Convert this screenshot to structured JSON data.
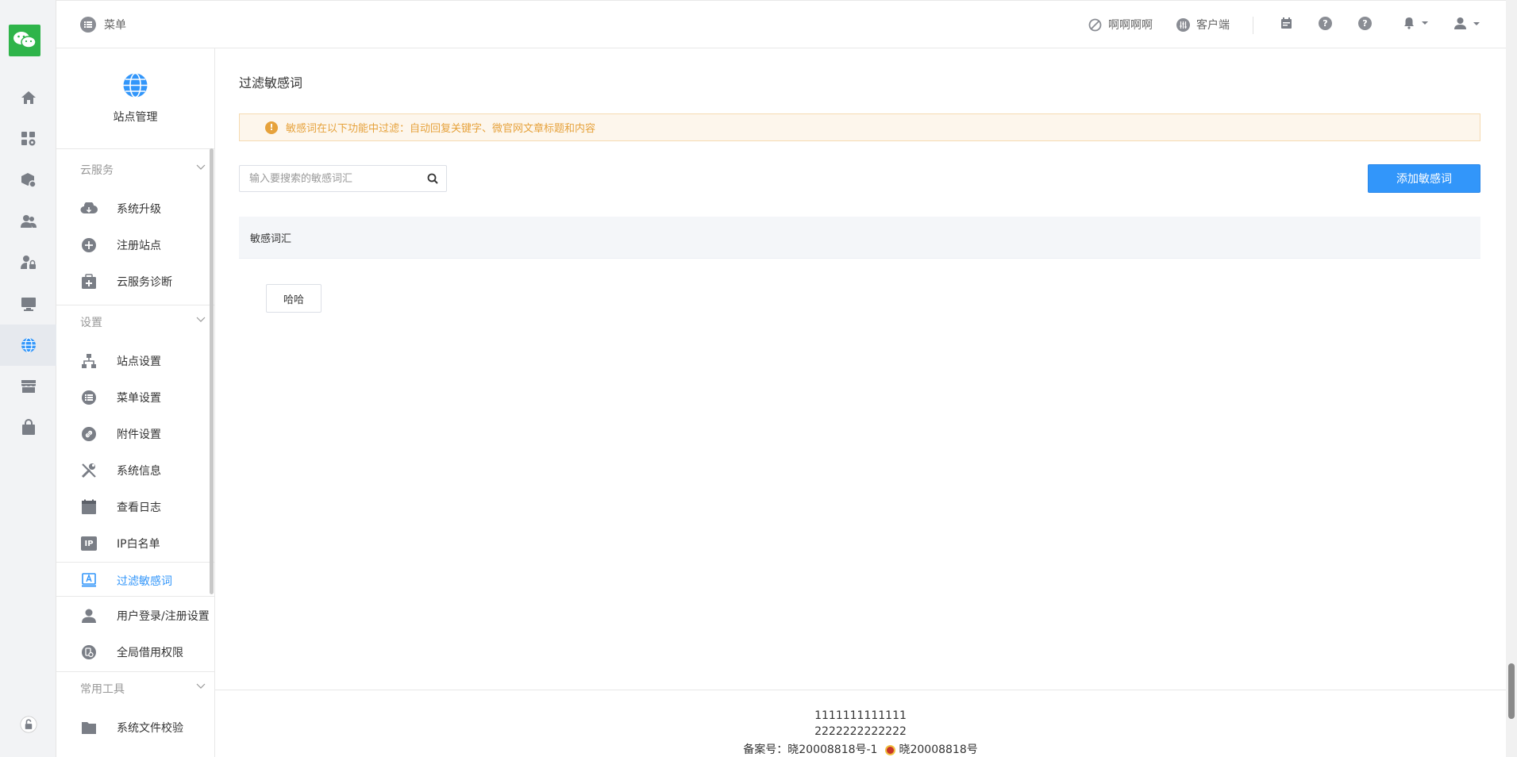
{
  "topbar": {
    "menu_label": "菜单",
    "link1": "啊啊啊啊",
    "link2": "客户端"
  },
  "sidebar": {
    "site_title": "站点管理",
    "sections": [
      {
        "title": "云服务",
        "items": [
          "系统升级",
          "注册站点",
          "云服务诊断"
        ]
      },
      {
        "title": "设置",
        "items": [
          "站点设置",
          "菜单设置",
          "附件设置",
          "系统信息",
          "查看日志",
          "IP白名单",
          "过滤敏感词",
          "用户登录/注册设置",
          "全局借用权限"
        ]
      },
      {
        "title": "常用工具",
        "items": [
          "系统文件校验"
        ]
      }
    ],
    "active_item": "过滤敏感词",
    "ip_badge": "IP"
  },
  "main": {
    "page_title": "过滤敏感词",
    "alert_text": "敏感词在以下功能中过滤：自动回复关键字、微官网文章标题和内容",
    "search_placeholder": "输入要搜索的敏感词汇",
    "add_button": "添加敏感词",
    "table_header": "敏感词汇",
    "words": [
      "哈哈"
    ]
  },
  "footer": {
    "line1": "1111111111111",
    "line2": "2222222222222",
    "icp": "备案号：晓20008818号-1",
    "police": "晓20008818号"
  },
  "colors": {
    "accent": "#3296fa",
    "warning": "#e6a23c",
    "logo_green": "#2fb44a"
  }
}
